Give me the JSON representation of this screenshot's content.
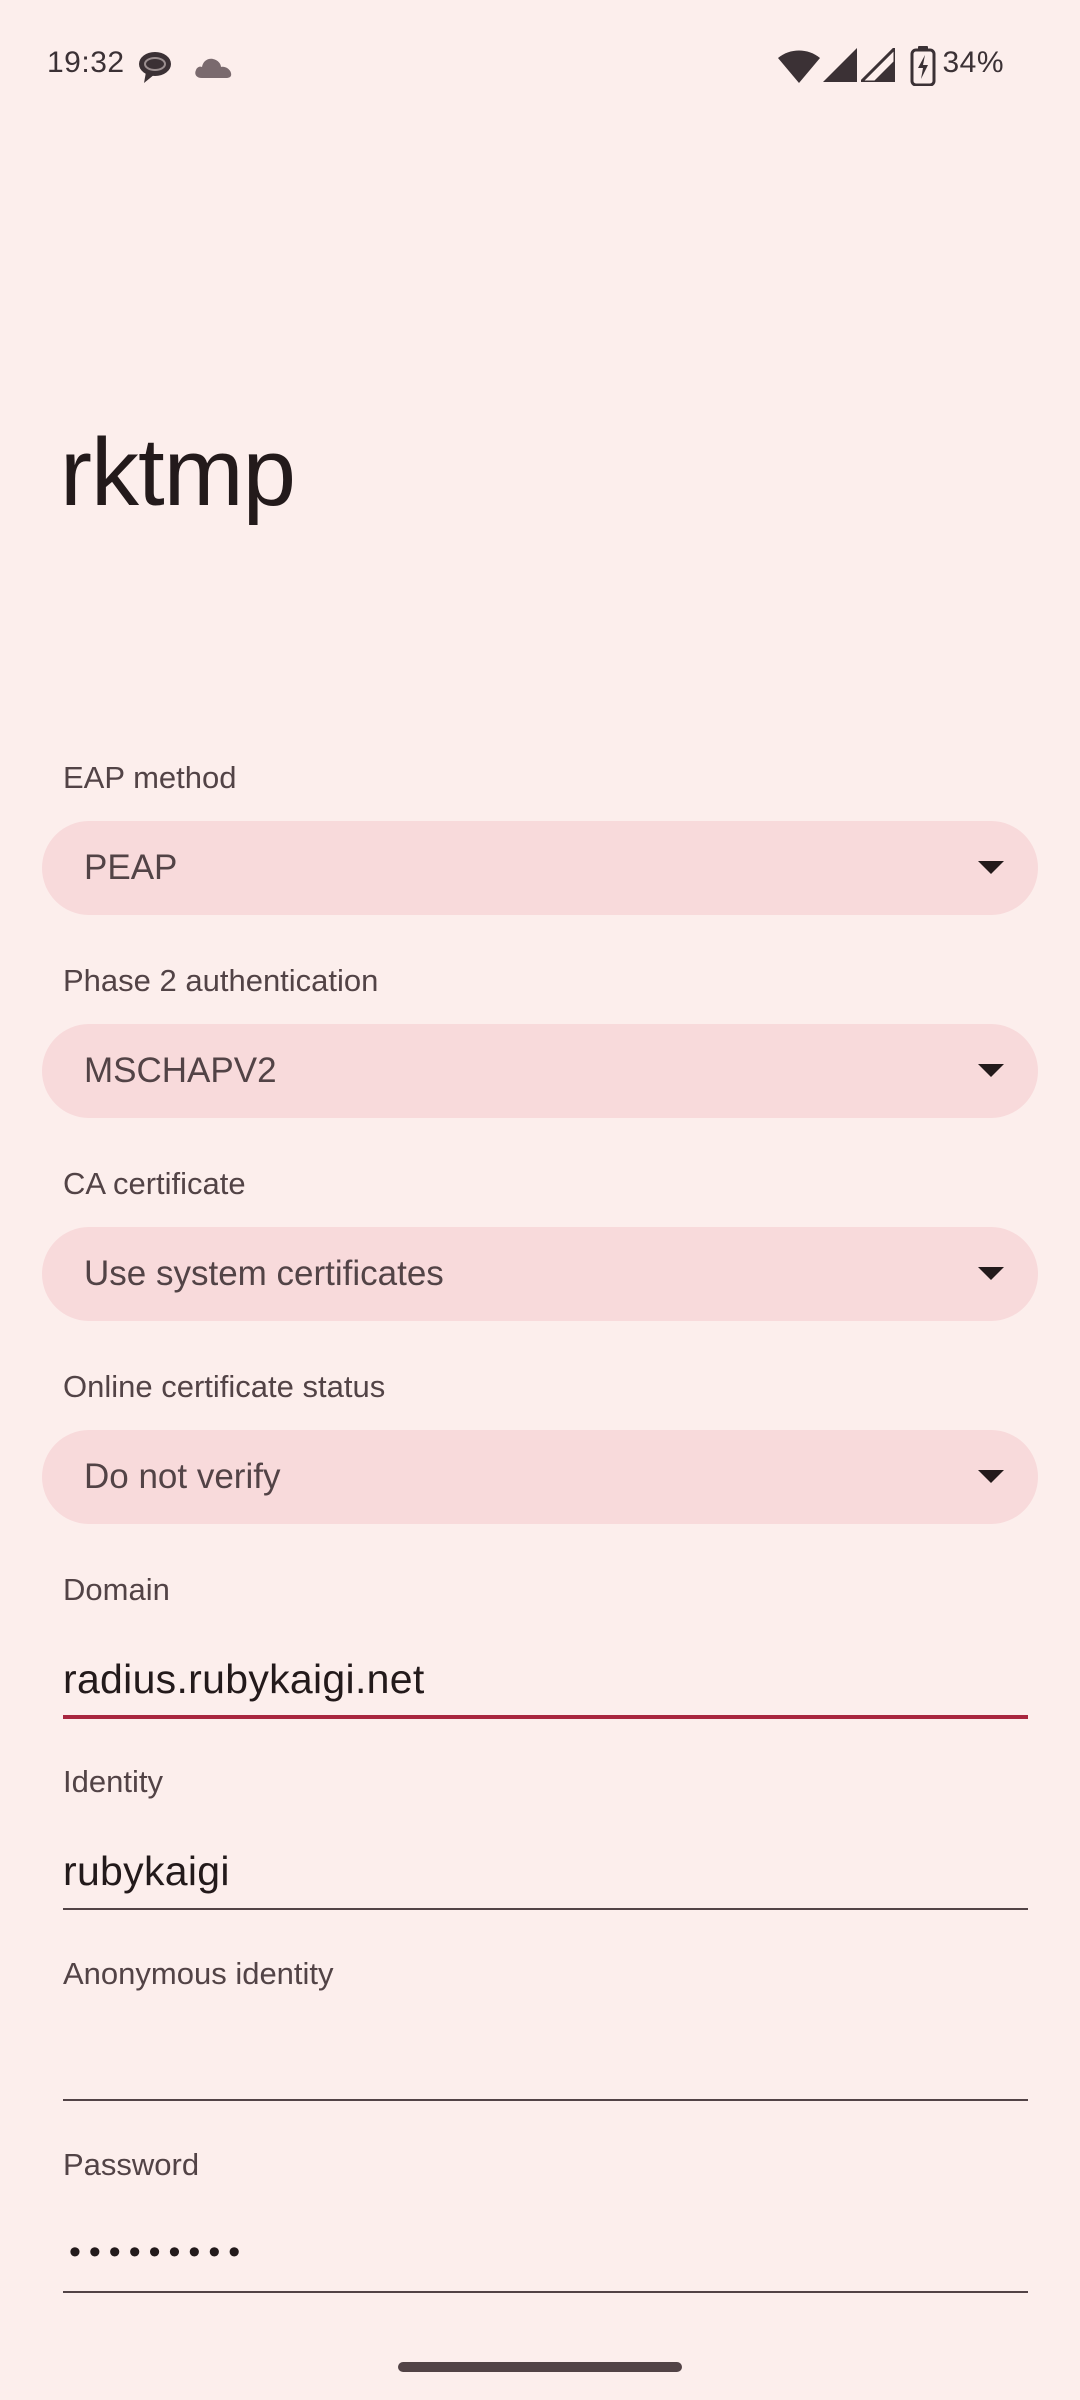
{
  "status_bar": {
    "time": "19:32",
    "battery_percent": "34%",
    "icons": [
      "chat-bubble-icon",
      "cloud-icon",
      "wifi-icon",
      "signal-icon",
      "signal-icon-2",
      "battery-charging-icon"
    ]
  },
  "network": {
    "title": "rktmp"
  },
  "form": {
    "eap_method": {
      "label": "EAP method",
      "value": "PEAP"
    },
    "phase2": {
      "label": "Phase 2 authentication",
      "value": "MSCHAPV2"
    },
    "ca_certificate": {
      "label": "CA certificate",
      "value": "Use system certificates"
    },
    "online_cert_status": {
      "label": "Online certificate status",
      "value": "Do not verify"
    },
    "domain": {
      "label": "Domain",
      "value": "radius.rubykaigi.net"
    },
    "identity": {
      "label": "Identity",
      "value": "rubykaigi"
    },
    "anonymous_identity": {
      "label": "Anonymous identity",
      "value": ""
    },
    "password": {
      "label": "Password",
      "masked_value": "•••••••••"
    }
  },
  "colors": {
    "background": "#FCEEEC",
    "dropdown_bg": "#F8DADB",
    "accent": "#A8263F",
    "text_primary": "#231A1B",
    "text_secondary": "#524346"
  }
}
